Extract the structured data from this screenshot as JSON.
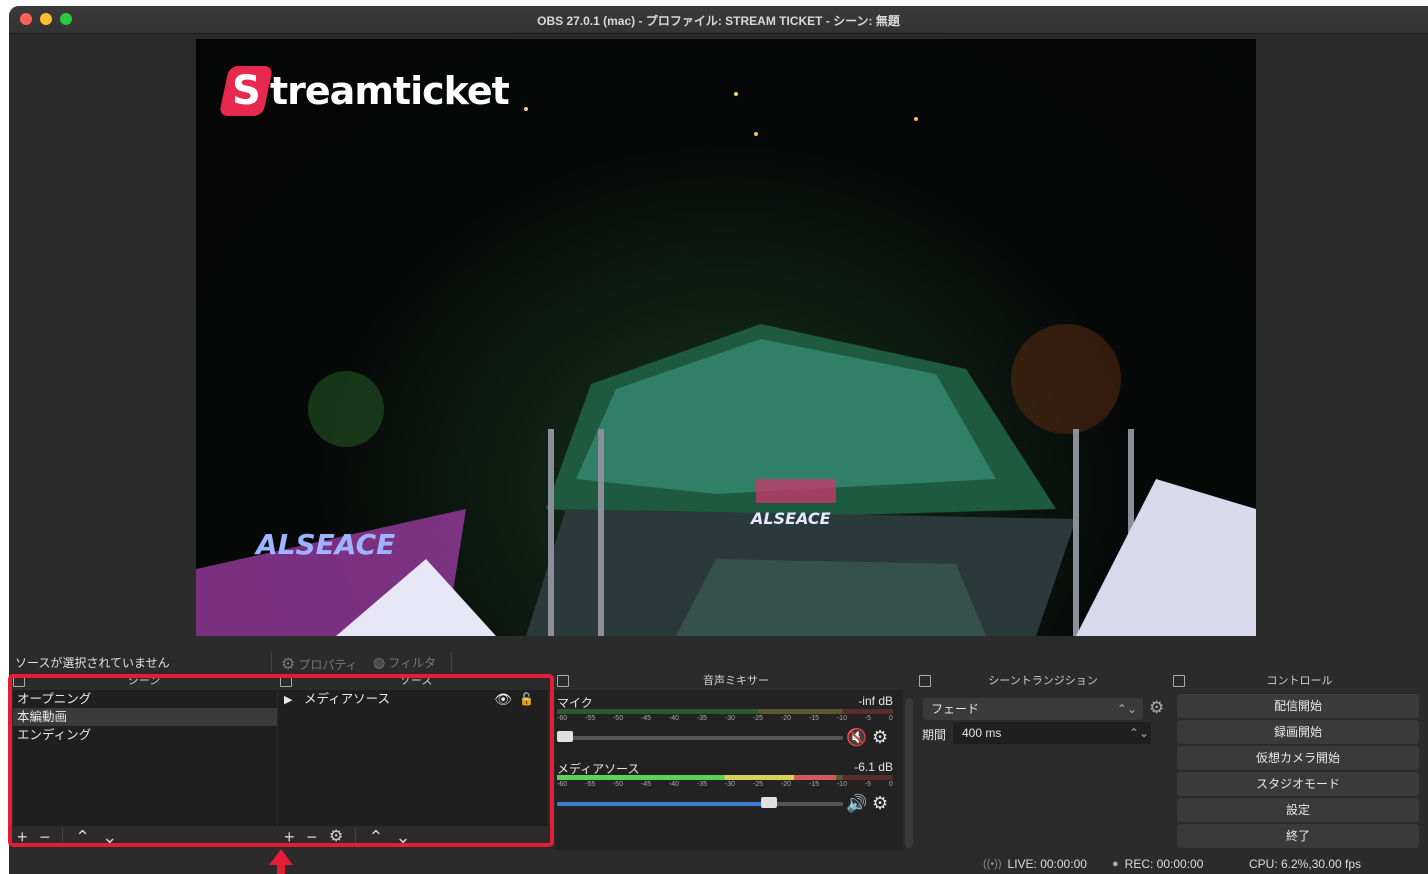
{
  "window": {
    "title": "OBS 27.0.1 (mac) - プロファイル: STREAM TICKET - シーン: 無題"
  },
  "preview": {
    "logo_letter": "S",
    "logo_text": "treamticket"
  },
  "source_bar": {
    "no_source_label": "ソースが選択されていません",
    "properties_label": "プロパティ",
    "filters_label": "フィルタ"
  },
  "scenes": {
    "title": "シーン",
    "items": [
      {
        "label": "オープニング",
        "selected": false
      },
      {
        "label": "本編動画",
        "selected": true
      },
      {
        "label": "エンディング",
        "selected": false
      }
    ]
  },
  "sources": {
    "title": "ソース",
    "items": [
      {
        "label": "メディアソース",
        "visible": true,
        "locked": false
      }
    ]
  },
  "mixer": {
    "title": "音声ミキサー",
    "ticks": [
      "-60",
      "-55",
      "-50",
      "-45",
      "-40",
      "-35",
      "-30",
      "-25",
      "-20",
      "-15",
      "-10",
      "-5",
      "0"
    ],
    "tracks": [
      {
        "name": "マイク",
        "db": "-inf dB",
        "level": 0.0,
        "volume": 0.0,
        "muted": true
      },
      {
        "name": "メディアソース",
        "db": "-6.1 dB",
        "level": 0.83,
        "volume": 0.74,
        "muted": false
      }
    ]
  },
  "transitions": {
    "title": "シーントランジション",
    "selected": "フェード",
    "duration_label": "期間",
    "duration_value": "400 ms"
  },
  "controls": {
    "title": "コントロール",
    "buttons": [
      "配信開始",
      "録画開始",
      "仮想カメラ開始",
      "スタジオモード",
      "設定",
      "終了"
    ]
  },
  "statusbar": {
    "live": "LIVE: 00:00:00",
    "rec": "REC: 00:00:00",
    "cpu": "CPU: 6.2%,30.00 fps"
  },
  "colors": {
    "highlight": "#e31c37",
    "logo": "#e8294f",
    "volume_slider": "#3c7bd6"
  }
}
